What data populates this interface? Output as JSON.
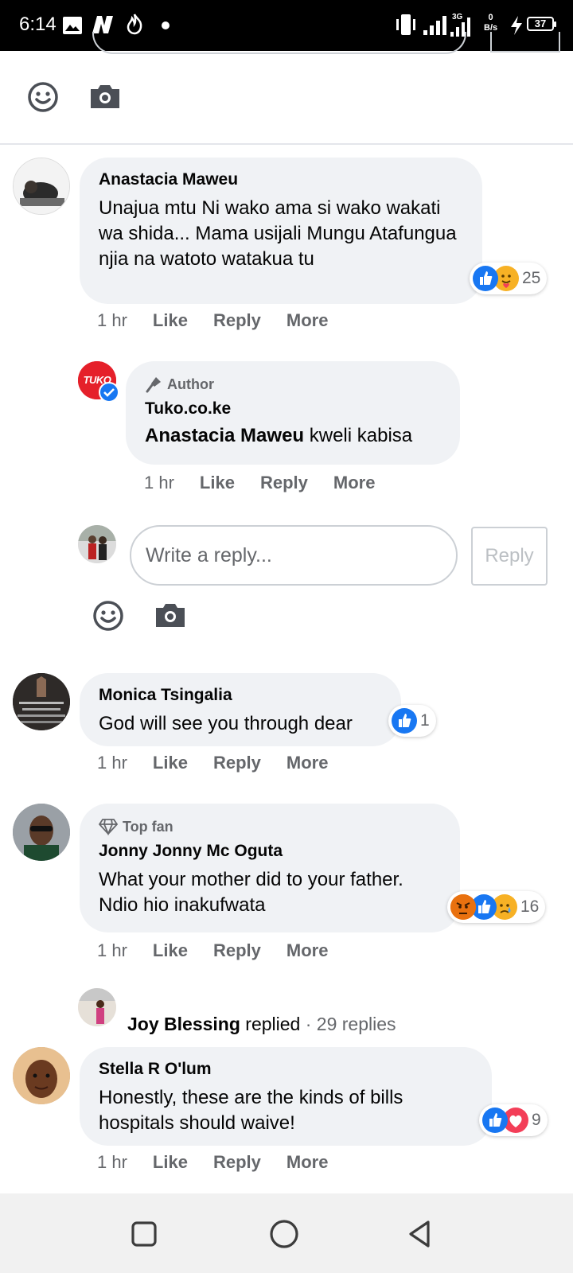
{
  "status_bar": {
    "time": "6:14",
    "net_speed_value": "0",
    "net_speed_unit": "B/s",
    "network_type": "3G",
    "battery": "37"
  },
  "reply_composer": {
    "placeholder": "Write a reply...",
    "button_label": "Reply"
  },
  "comments": [
    {
      "author": "Anastacia Maweu",
      "text": "Unajua mtu Ni wako ama si wako wakati wa shida... Mama usijali Mungu Atafungua njia na watoto watakua tu",
      "time": "1 hr",
      "reaction_count": "25",
      "reaction_icons": [
        "like-icon",
        "care-icon"
      ]
    },
    {
      "badge": "Author",
      "author": "Tuko.co.ke",
      "mention": "Anastacia Maweu",
      "text": " kweli kabisa",
      "time": "1 hr"
    },
    {
      "author": "Monica Tsingalia",
      "text": "God will see you through dear",
      "time": "1 hr",
      "reaction_count": "1",
      "reaction_icons": [
        "like-icon"
      ]
    },
    {
      "badge": "Top fan",
      "author": "Jonny Jonny Mc Oguta",
      "text": "What your mother did to your father. Ndio hio inakufwata",
      "time": "1 hr",
      "reaction_count": "16",
      "reaction_icons": [
        "angry-icon",
        "like-icon",
        "sad-icon"
      ]
    },
    {
      "author": "Stella R O'lum",
      "text": "Honestly, these are the kinds of bills hospitals should waive!",
      "time": "1 hr",
      "reaction_count": "9",
      "reaction_icons": [
        "like-icon",
        "love-icon"
      ]
    }
  ],
  "actions": {
    "like": "Like",
    "reply": "Reply",
    "more": "More"
  },
  "replied_summary": {
    "name": "Joy Blessing",
    "verb": "replied",
    "separator": " · ",
    "count": "29 replies"
  },
  "avatar_logo_text": "TUKO",
  "colors": {
    "bubble": "#f0f2f5",
    "secondary_text": "#65676b",
    "like_blue": "#1877f2",
    "love_red": "#f33e58",
    "tuko_red": "#e5202a"
  }
}
